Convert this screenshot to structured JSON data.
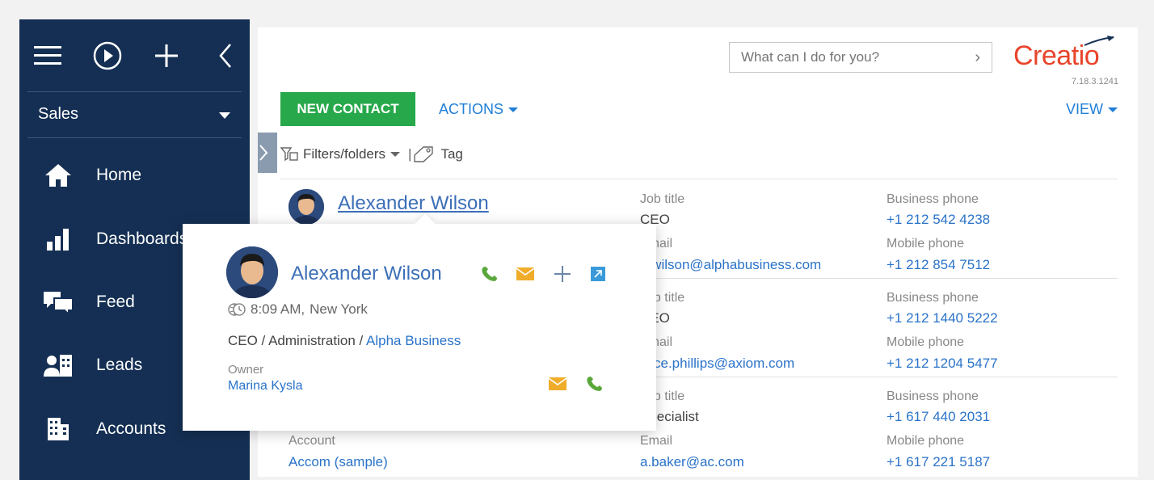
{
  "sidebar": {
    "top_icons": [
      "menu-icon",
      "play-icon",
      "plus-icon",
      "chevron-left-icon"
    ],
    "section": "Sales",
    "items": [
      {
        "label": "Home",
        "icon": "home-icon"
      },
      {
        "label": "Dashboards",
        "icon": "dashboard-icon"
      },
      {
        "label": "Feed",
        "icon": "feed-icon"
      },
      {
        "label": "Leads",
        "icon": "leads-icon"
      },
      {
        "label": "Accounts",
        "icon": "accounts-icon"
      }
    ]
  },
  "header": {
    "search_placeholder": "What can I do for you?",
    "logo": "Creatio",
    "version": "7.18.3.1241"
  },
  "toolbar": {
    "new_contact": "NEW CONTACT",
    "actions": "ACTIONS",
    "view": "VIEW",
    "filters": "Filters/folders",
    "tag": "Tag"
  },
  "contacts": [
    {
      "name": "Alexander Wilson",
      "job_title_label": "Job title",
      "job_title": "CEO",
      "email_label": "Email",
      "email": "a.wilson@alphabusiness.com",
      "business_phone_label": "Business phone",
      "business_phone": "+1 212 542 4238",
      "mobile_phone_label": "Mobile phone",
      "mobile_phone": "+1 212 854 7512"
    },
    {
      "job_title_label": "Job title",
      "job_title": "CEO",
      "email_label": "Email",
      "email": "alice.phillips@axiom.com",
      "business_phone_label": "Business phone",
      "business_phone": "+1 212 1440 5222",
      "mobile_phone_label": "Mobile phone",
      "mobile_phone": "+1 212 1204 5477"
    },
    {
      "job_title_label": "Job title",
      "job_title": "Specialist",
      "account_label": "Account",
      "account": "Accom (sample)",
      "email_label": "Email",
      "email": "a.baker@ac.com",
      "business_phone_label": "Business phone",
      "business_phone": "+1 617 440 2031",
      "mobile_phone_label": "Mobile phone",
      "mobile_phone": "+1 617 221 5187"
    }
  ],
  "popup": {
    "name": "Alexander Wilson",
    "time": "8:09 AM,",
    "city": "New York",
    "job": "CEO / Administration /",
    "company": "Alpha Business",
    "owner_label": "Owner",
    "owner": "Marina Kysla"
  },
  "colors": {
    "sidebar_bg": "#142f53",
    "primary_button": "#27a84a",
    "link": "#2a73c9",
    "logo": "#e8442a",
    "call_icon": "#5aa83c",
    "email_icon": "#f0ad2b"
  }
}
